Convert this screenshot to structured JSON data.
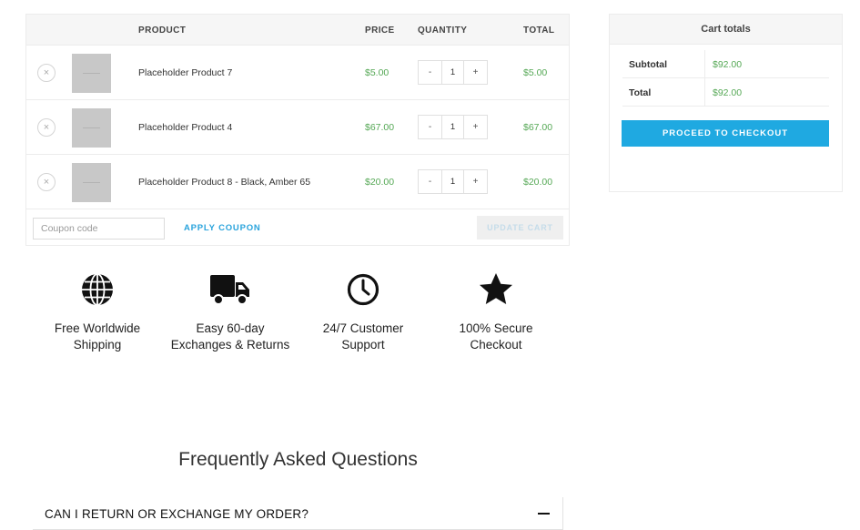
{
  "cart": {
    "headers": {
      "product": "PRODUCT",
      "price": "PRICE",
      "quantity": "QUANTITY",
      "total": "TOTAL"
    },
    "items": [
      {
        "name": "Placeholder Product 7",
        "price": "$5.00",
        "qty": "1",
        "total": "$5.00"
      },
      {
        "name": "Placeholder Product 4",
        "price": "$67.00",
        "qty": "1",
        "total": "$67.00"
      },
      {
        "name": "Placeholder Product 8 - Black, Amber 65",
        "price": "$20.00",
        "qty": "1",
        "total": "$20.00"
      }
    ],
    "remove_glyph": "×",
    "minus": "-",
    "plus": "+",
    "coupon_placeholder": "Coupon code",
    "apply_label": "APPLY COUPON",
    "update_label": "UPDATE CART"
  },
  "totals": {
    "title": "Cart totals",
    "subtotal_label": "Subtotal",
    "subtotal_value": "$92.00",
    "total_label": "Total",
    "total_value": "$92.00",
    "checkout_label": "PROCEED TO CHECKOUT"
  },
  "features": [
    {
      "icon": "globe-icon",
      "text": "Free Worldwide\nShipping"
    },
    {
      "icon": "truck-icon",
      "text": "Easy 60-day\nExchanges & Returns"
    },
    {
      "icon": "clock-icon",
      "text": "24/7 Customer\nSupport"
    },
    {
      "icon": "star-icon",
      "text": "100% Secure\nCheckout"
    }
  ],
  "faq": {
    "title": "Frequently Asked Questions",
    "items": [
      {
        "question": "CAN I RETURN OR EXCHANGE MY ORDER?",
        "toggle": "minus-icon"
      }
    ]
  },
  "colors": {
    "accent": "#1fa9e1",
    "price": "#55a855"
  }
}
